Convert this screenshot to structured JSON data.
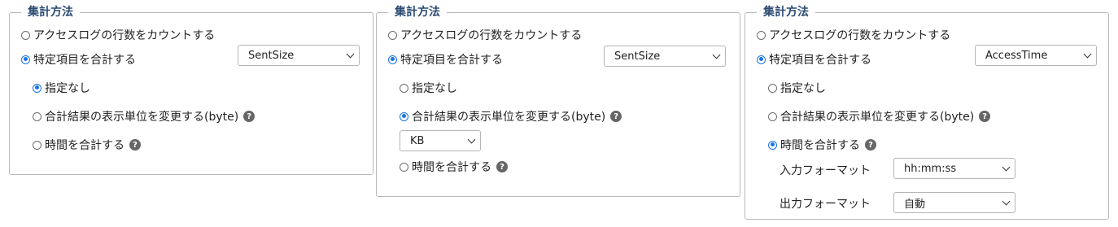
{
  "panels": [
    {
      "title": "集計方法",
      "count_rows_label": "アクセスログの行数をカウントする",
      "sum_item_label": "特定項目を合計する",
      "sum_field": "SentSize",
      "no_spec_label": "指定なし",
      "change_unit_label": "合計結果の表示単位を変更する(byte)",
      "sum_time_label": "時間を合計する",
      "help_glyph": "?"
    },
    {
      "title": "集計方法",
      "count_rows_label": "アクセスログの行数をカウントする",
      "sum_item_label": "特定項目を合計する",
      "sum_field": "SentSize",
      "no_spec_label": "指定なし",
      "change_unit_label": "合計結果の表示単位を変更する(byte)",
      "unit": "KB",
      "sum_time_label": "時間を合計する",
      "help_glyph": "?"
    },
    {
      "title": "集計方法",
      "count_rows_label": "アクセスログの行数をカウントする",
      "sum_item_label": "特定項目を合計する",
      "sum_field": "AccessTime",
      "no_spec_label": "指定なし",
      "change_unit_label": "合計結果の表示単位を変更する(byte)",
      "sum_time_label": "時間を合計する",
      "input_format_label": "入力フォーマット",
      "input_format": "hh:mm:ss",
      "output_format_label": "出力フォーマット",
      "output_format": "自動",
      "help_glyph": "?"
    }
  ]
}
